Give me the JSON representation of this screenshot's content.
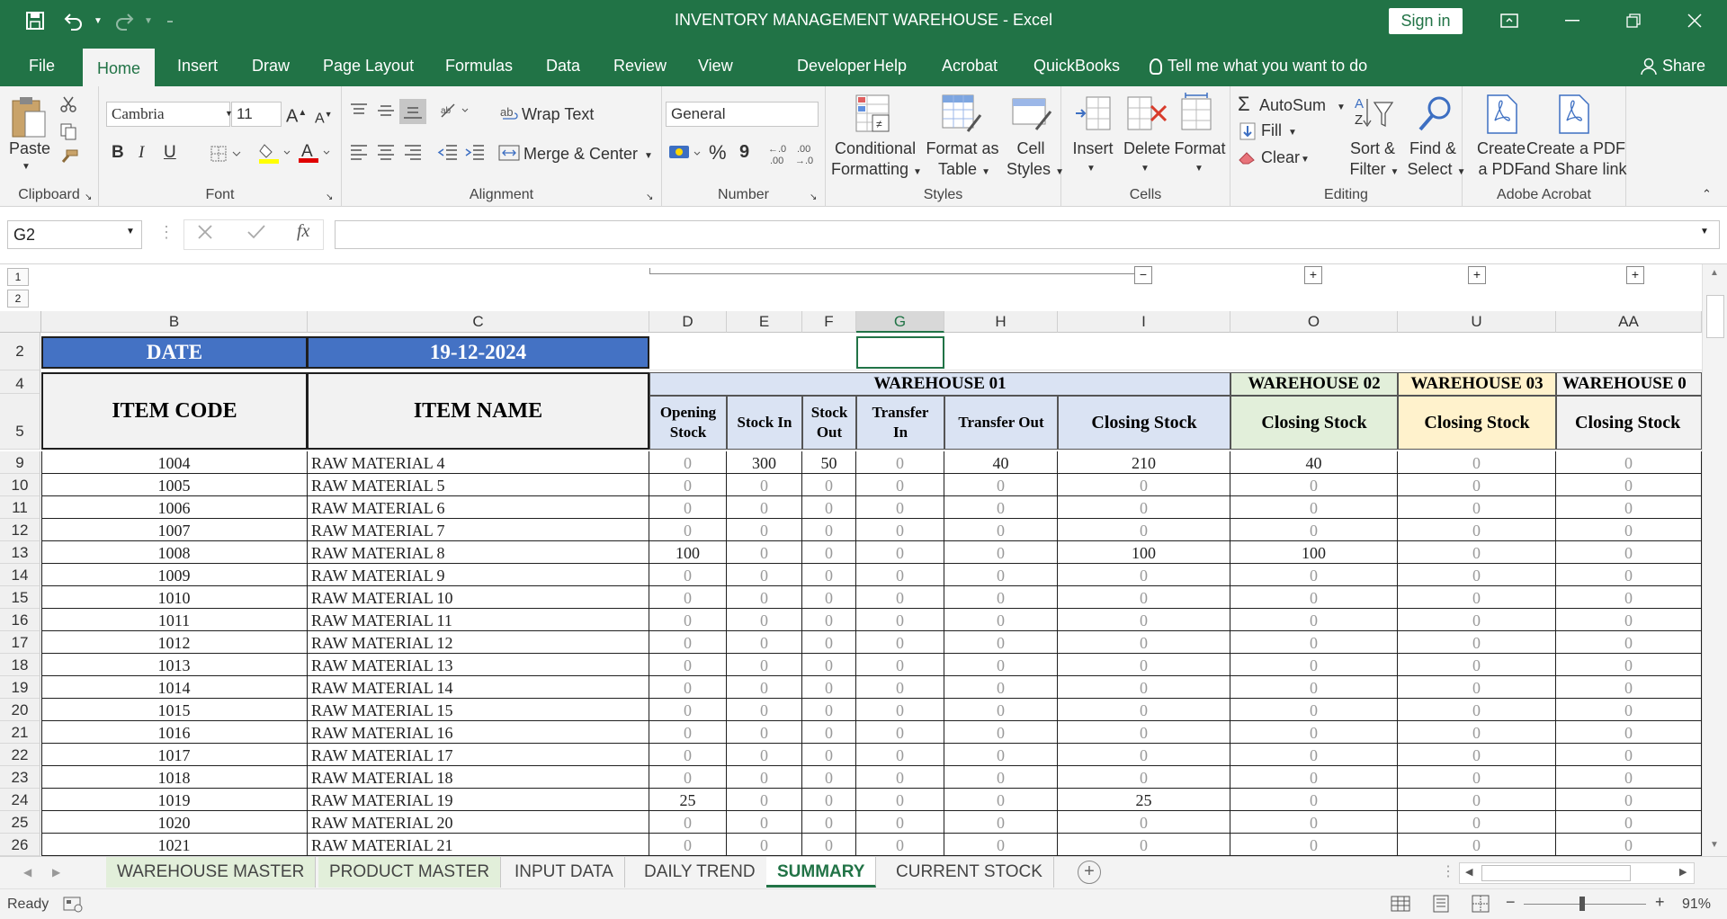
{
  "window": {
    "title": "INVENTORY MANAGEMENT WAREHOUSE  -  Excel",
    "sign_in": "Sign in"
  },
  "menu": {
    "tabs": [
      "File",
      "Home",
      "Insert",
      "Draw",
      "Page Layout",
      "Formulas",
      "Data",
      "Review",
      "View",
      "Developer",
      "Help",
      "Acrobat",
      "QuickBooks"
    ],
    "tell_me": "Tell me what you want to do",
    "share": "Share"
  },
  "ribbon": {
    "clipboard": {
      "paste": "Paste",
      "label": "Clipboard"
    },
    "font": {
      "name": "Cambria",
      "size": "11",
      "label": "Font",
      "bold": "B",
      "italic": "I",
      "underline": "U"
    },
    "alignment": {
      "wrap": "Wrap Text",
      "merge": "Merge & Center",
      "label": "Alignment"
    },
    "number": {
      "format": "General",
      "percent": "%",
      "comma": "9",
      "label": "Number"
    },
    "styles": {
      "conditional": [
        "Conditional",
        "Formatting"
      ],
      "format_table": [
        "Format as",
        "Table"
      ],
      "cell_styles": [
        "Cell",
        "Styles"
      ],
      "label": "Styles"
    },
    "cells": {
      "insert": "Insert",
      "delete": "Delete",
      "format": "Format",
      "label": "Cells"
    },
    "editing": {
      "autosum": "AutoSum",
      "fill": "Fill",
      "clear": "Clear",
      "sort": [
        "Sort &",
        "Filter"
      ],
      "find": [
        "Find &",
        "Select"
      ],
      "label": "Editing"
    },
    "acrobat": {
      "create_pdf": [
        "Create",
        "a PDF"
      ],
      "create_share": [
        "Create a PDF",
        "and Share link"
      ],
      "label": "Adobe Acrobat"
    }
  },
  "formula_bar": {
    "name_box": "G2",
    "formula": ""
  },
  "outline": {
    "levels": [
      "1",
      "2"
    ]
  },
  "columns": [
    "B",
    "C",
    "D",
    "E",
    "F",
    "G",
    "H",
    "I",
    "O",
    "U",
    "AA"
  ],
  "sheet": {
    "date_label": "DATE",
    "date_value": "19-12-2024",
    "item_code_header": "ITEM CODE",
    "item_name_header": "ITEM NAME",
    "wh1_title": "WAREHOUSE 01",
    "wh1_cols": [
      [
        "Opening",
        "Stock"
      ],
      [
        "Stock In"
      ],
      [
        "Stock",
        "Out"
      ],
      [
        "Transfer",
        "In"
      ],
      [
        "Transfer Out"
      ],
      [
        "Closing Stock"
      ]
    ],
    "wh2_title": "WAREHOUSE 02",
    "wh3_title": "WAREHOUSE 03",
    "wh4_title": "WAREHOUSE 0",
    "closing_label": "Closing Stock",
    "header_rows": [
      "2",
      "4",
      "5"
    ],
    "rows": [
      {
        "r": "9",
        "code": "1004",
        "name": "RAW MATERIAL 4",
        "v": [
          "0",
          "300",
          "50",
          "0",
          "40",
          "210",
          "40",
          "0",
          "0"
        ]
      },
      {
        "r": "10",
        "code": "1005",
        "name": "RAW MATERIAL 5",
        "v": [
          "0",
          "0",
          "0",
          "0",
          "0",
          "0",
          "0",
          "0",
          "0"
        ]
      },
      {
        "r": "11",
        "code": "1006",
        "name": "RAW MATERIAL 6",
        "v": [
          "0",
          "0",
          "0",
          "0",
          "0",
          "0",
          "0",
          "0",
          "0"
        ]
      },
      {
        "r": "12",
        "code": "1007",
        "name": "RAW MATERIAL 7",
        "v": [
          "0",
          "0",
          "0",
          "0",
          "0",
          "0",
          "0",
          "0",
          "0"
        ]
      },
      {
        "r": "13",
        "code": "1008",
        "name": "RAW MATERIAL 8",
        "v": [
          "100",
          "0",
          "0",
          "0",
          "0",
          "100",
          "100",
          "0",
          "0"
        ]
      },
      {
        "r": "14",
        "code": "1009",
        "name": "RAW MATERIAL 9",
        "v": [
          "0",
          "0",
          "0",
          "0",
          "0",
          "0",
          "0",
          "0",
          "0"
        ]
      },
      {
        "r": "15",
        "code": "1010",
        "name": "RAW MATERIAL 10",
        "v": [
          "0",
          "0",
          "0",
          "0",
          "0",
          "0",
          "0",
          "0",
          "0"
        ]
      },
      {
        "r": "16",
        "code": "1011",
        "name": "RAW MATERIAL 11",
        "v": [
          "0",
          "0",
          "0",
          "0",
          "0",
          "0",
          "0",
          "0",
          "0"
        ]
      },
      {
        "r": "17",
        "code": "1012",
        "name": "RAW MATERIAL 12",
        "v": [
          "0",
          "0",
          "0",
          "0",
          "0",
          "0",
          "0",
          "0",
          "0"
        ]
      },
      {
        "r": "18",
        "code": "1013",
        "name": "RAW MATERIAL 13",
        "v": [
          "0",
          "0",
          "0",
          "0",
          "0",
          "0",
          "0",
          "0",
          "0"
        ]
      },
      {
        "r": "19",
        "code": "1014",
        "name": "RAW MATERIAL 14",
        "v": [
          "0",
          "0",
          "0",
          "0",
          "0",
          "0",
          "0",
          "0",
          "0"
        ]
      },
      {
        "r": "20",
        "code": "1015",
        "name": "RAW MATERIAL 15",
        "v": [
          "0",
          "0",
          "0",
          "0",
          "0",
          "0",
          "0",
          "0",
          "0"
        ]
      },
      {
        "r": "21",
        "code": "1016",
        "name": "RAW MATERIAL 16",
        "v": [
          "0",
          "0",
          "0",
          "0",
          "0",
          "0",
          "0",
          "0",
          "0"
        ]
      },
      {
        "r": "22",
        "code": "1017",
        "name": "RAW MATERIAL 17",
        "v": [
          "0",
          "0",
          "0",
          "0",
          "0",
          "0",
          "0",
          "0",
          "0"
        ]
      },
      {
        "r": "23",
        "code": "1018",
        "name": "RAW MATERIAL 18",
        "v": [
          "0",
          "0",
          "0",
          "0",
          "0",
          "0",
          "0",
          "0",
          "0"
        ]
      },
      {
        "r": "24",
        "code": "1019",
        "name": "RAW MATERIAL 19",
        "v": [
          "25",
          "0",
          "0",
          "0",
          "0",
          "25",
          "0",
          "0",
          "0"
        ]
      },
      {
        "r": "25",
        "code": "1020",
        "name": "RAW MATERIAL 20",
        "v": [
          "0",
          "0",
          "0",
          "0",
          "0",
          "0",
          "0",
          "0",
          "0"
        ]
      },
      {
        "r": "26",
        "code": "1021",
        "name": "RAW MATERIAL 21",
        "v": [
          "0",
          "0",
          "0",
          "0",
          "0",
          "0",
          "0",
          "0",
          "0"
        ]
      }
    ]
  },
  "sheet_tabs": [
    {
      "label": "WAREHOUSE MASTER",
      "color": "#e2efda",
      "active": false
    },
    {
      "label": "PRODUCT MASTER",
      "color": "#e2efda",
      "active": false
    },
    {
      "label": "INPUT DATA",
      "color": "",
      "active": false
    },
    {
      "label": "DAILY TREND",
      "color": "",
      "active": false
    },
    {
      "label": "SUMMARY",
      "color": "",
      "active": true
    },
    {
      "label": "CURRENT STOCK",
      "color": "",
      "active": false
    }
  ],
  "status": {
    "ready": "Ready",
    "zoom": "91%"
  },
  "colors": {
    "excel_green": "#217346",
    "date_blue": "#4472c4",
    "wh1": "#dae3f3",
    "wh2": "#e2efda",
    "wh3": "#fff2cc"
  }
}
